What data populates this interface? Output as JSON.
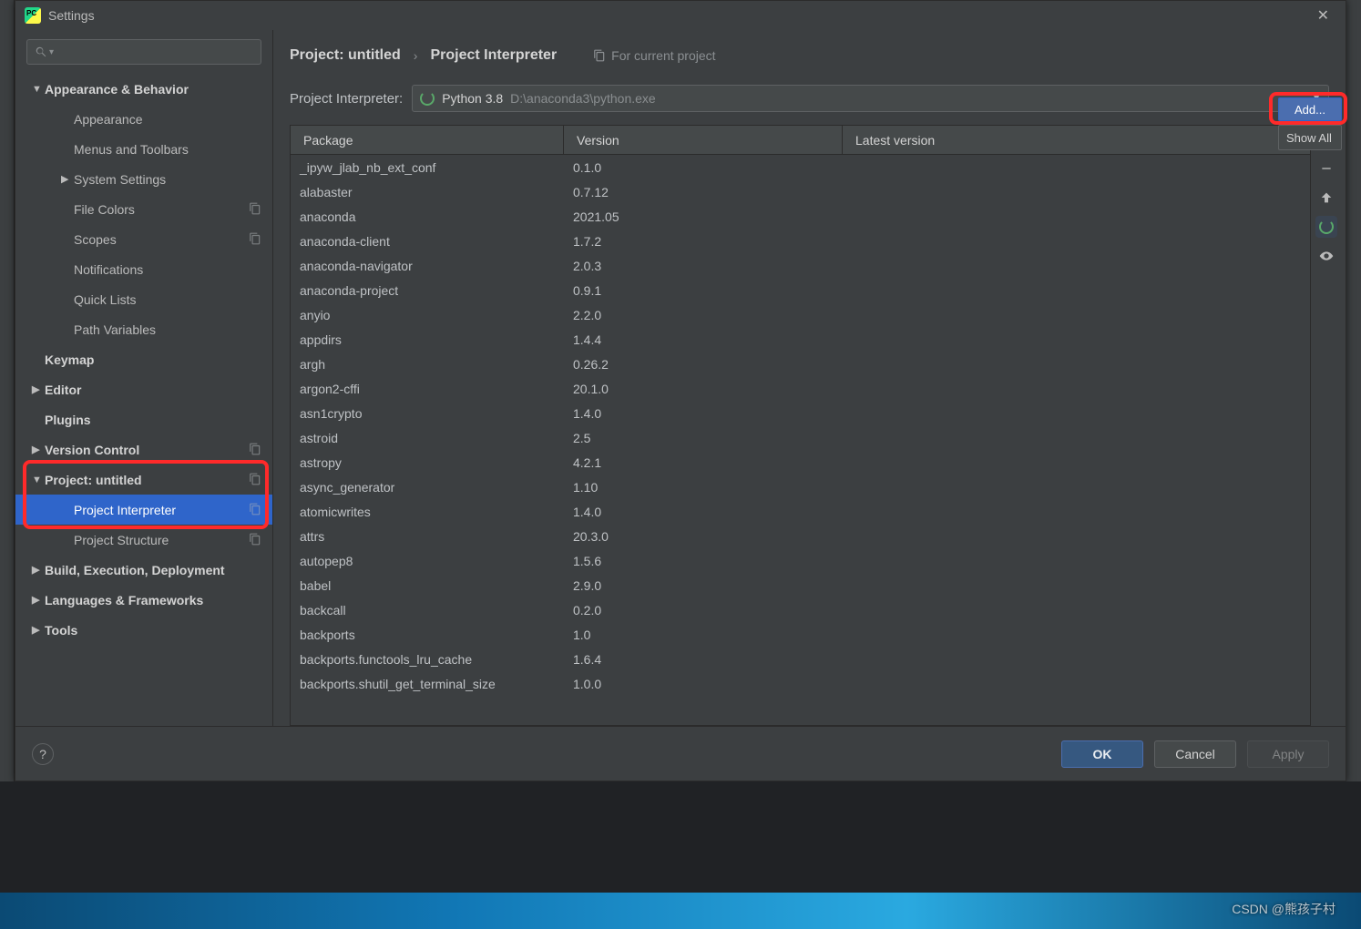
{
  "window": {
    "title": "Settings"
  },
  "breadcrumb": {
    "a": "Project: untitled",
    "b": "Project Interpreter",
    "hint": "For current project"
  },
  "interpreter": {
    "label": "Project Interpreter:",
    "name": "Python 3.8",
    "path": "D:\\anaconda3\\python.exe",
    "add": "Add...",
    "showall": "Show All"
  },
  "sidebar": {
    "items": [
      {
        "label": "Appearance & Behavior",
        "bold": true,
        "arrow": "down"
      },
      {
        "label": "Appearance",
        "level": 2
      },
      {
        "label": "Menus and Toolbars",
        "level": 2
      },
      {
        "label": "System Settings",
        "level": 2,
        "arrow": "right"
      },
      {
        "label": "File Colors",
        "level": 2,
        "copy": true
      },
      {
        "label": "Scopes",
        "level": 2,
        "copy": true
      },
      {
        "label": "Notifications",
        "level": 2
      },
      {
        "label": "Quick Lists",
        "level": 2
      },
      {
        "label": "Path Variables",
        "level": 2
      },
      {
        "label": "Keymap",
        "bold": true
      },
      {
        "label": "Editor",
        "bold": true,
        "arrow": "right"
      },
      {
        "label": "Plugins",
        "bold": true
      },
      {
        "label": "Version Control",
        "bold": true,
        "arrow": "right",
        "copy": true
      },
      {
        "label": "Project: untitled",
        "bold": true,
        "arrow": "down",
        "copy": true
      },
      {
        "label": "Project Interpreter",
        "level": 2,
        "copy": true,
        "selected": true
      },
      {
        "label": "Project Structure",
        "level": 2,
        "copy": true
      },
      {
        "label": "Build, Execution, Deployment",
        "bold": true,
        "arrow": "right"
      },
      {
        "label": "Languages & Frameworks",
        "bold": true,
        "arrow": "right"
      },
      {
        "label": "Tools",
        "bold": true,
        "arrow": "right"
      }
    ]
  },
  "table": {
    "headers": {
      "pkg": "Package",
      "ver": "Version",
      "latest": "Latest version"
    }
  },
  "packages": [
    {
      "name": "_ipyw_jlab_nb_ext_conf",
      "version": "0.1.0",
      "spinner": true
    },
    {
      "name": "alabaster",
      "version": "0.7.12"
    },
    {
      "name": "anaconda",
      "version": "2021.05"
    },
    {
      "name": "anaconda-client",
      "version": "1.7.2"
    },
    {
      "name": "anaconda-navigator",
      "version": "2.0.3"
    },
    {
      "name": "anaconda-project",
      "version": "0.9.1"
    },
    {
      "name": "anyio",
      "version": "2.2.0"
    },
    {
      "name": "appdirs",
      "version": "1.4.4"
    },
    {
      "name": "argh",
      "version": "0.26.2"
    },
    {
      "name": "argon2-cffi",
      "version": "20.1.0"
    },
    {
      "name": "asn1crypto",
      "version": "1.4.0"
    },
    {
      "name": "astroid",
      "version": "2.5"
    },
    {
      "name": "astropy",
      "version": "4.2.1"
    },
    {
      "name": "async_generator",
      "version": "1.10"
    },
    {
      "name": "atomicwrites",
      "version": "1.4.0"
    },
    {
      "name": "attrs",
      "version": "20.3.0"
    },
    {
      "name": "autopep8",
      "version": "1.5.6"
    },
    {
      "name": "babel",
      "version": "2.9.0"
    },
    {
      "name": "backcall",
      "version": "0.2.0"
    },
    {
      "name": "backports",
      "version": "1.0"
    },
    {
      "name": "backports.functools_lru_cache",
      "version": "1.6.4"
    },
    {
      "name": "backports.shutil_get_terminal_size",
      "version": "1.0.0"
    }
  ],
  "footer": {
    "ok": "OK",
    "cancel": "Cancel",
    "apply": "Apply",
    "help": "?"
  },
  "watermark": "CSDN @熊孩子村"
}
